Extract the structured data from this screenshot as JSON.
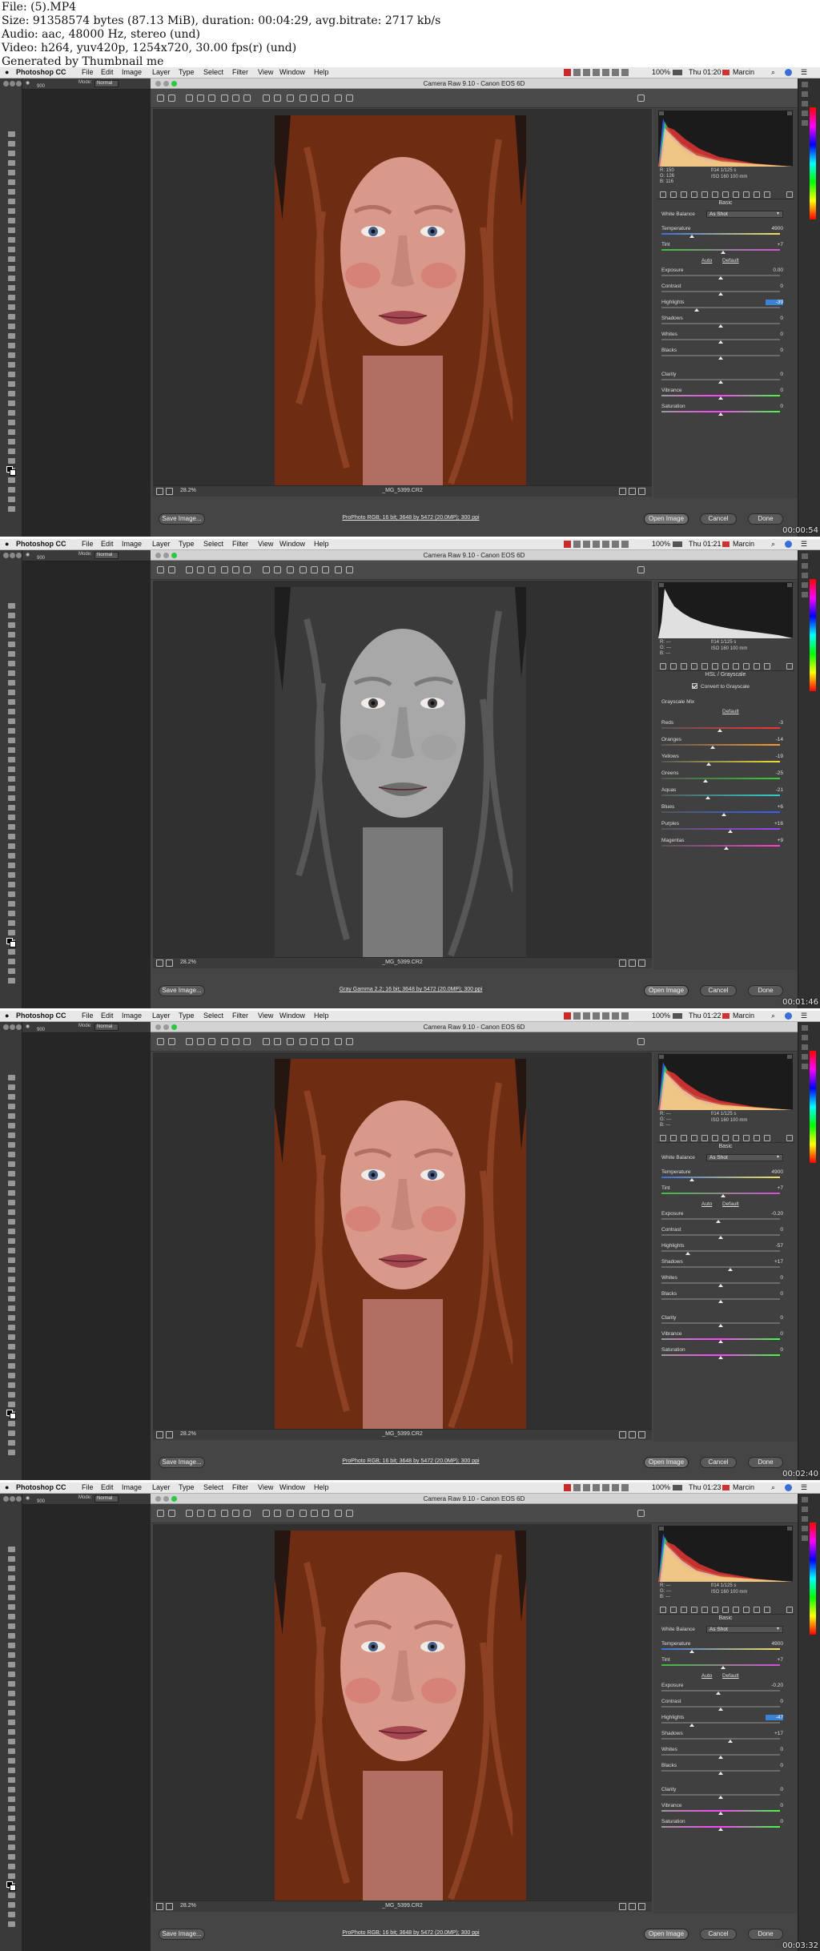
{
  "info": {
    "lines": [
      "File: (5).MP4",
      "Size: 91358574 bytes (87.13 MiB), duration: 00:04:29, avg.bitrate: 2717 kb/s",
      "Audio: aac, 48000 Hz, stereo (und)",
      "Video: h264, yuv420p, 1254x720, 30.00 fps(r) (und)",
      "Generated by Thumbnail me"
    ]
  },
  "common": {
    "app": "Photoshop CC",
    "menus": [
      "File",
      "Edit",
      "Image",
      "Layer",
      "Type",
      "Select",
      "Filter",
      "View",
      "Window",
      "Help"
    ],
    "window_title": "Camera Raw 9.10 - Canon EOS 6D",
    "user": "Marcin",
    "battery": "100%",
    "camera_line1": "f/14   1/125 s",
    "camera_line2": "ISO 160   100 mm",
    "zoom": "28.2%",
    "file_name": "_MG_5399.CR2",
    "save_button": "Save Image...",
    "open_button": "Open Image",
    "cancel_button": "Cancel",
    "done_button": "Done",
    "brush_size": "900",
    "mode_label": "Mode:",
    "mode_value": "Normal",
    "auto_label": "Auto",
    "default_label": "Default",
    "convert_label": "Convert to Grayscale",
    "grayscale_mix_label": "Grayscale Mix"
  },
  "frames": [
    {
      "time": "Thu 01:20",
      "timestamp": "00:00:54",
      "mode": "color",
      "panel_title": "Basic",
      "rgb": [
        "R: 150",
        "G: 126",
        "B: 116"
      ],
      "workflow": "ProPhoto RGB; 16 bit; 3648 by 5472 (20.0MP); 300 ppi",
      "wb_value": "As Shot",
      "rows": [
        {
          "label": "White Balance",
          "type": "wb"
        },
        {
          "label": "Temperature",
          "value": "4900",
          "pos": 0.26,
          "grad": "temp"
        },
        {
          "label": "Tint",
          "value": "+7",
          "pos": 0.52,
          "grad": "tint"
        },
        {
          "type": "auto"
        },
        {
          "label": "Exposure",
          "value": "0.00",
          "pos": 0.5
        },
        {
          "label": "Contrast",
          "value": "0",
          "pos": 0.5
        },
        {
          "label": "Highlights",
          "value": "-39",
          "pos": 0.3,
          "hl": true
        },
        {
          "label": "Shadows",
          "value": "0",
          "pos": 0.5
        },
        {
          "label": "Whites",
          "value": "0",
          "pos": 0.5
        },
        {
          "label": "Blacks",
          "value": "0",
          "pos": 0.5
        },
        {
          "type": "gap"
        },
        {
          "label": "Clarity",
          "value": "0",
          "pos": 0.5
        },
        {
          "label": "Vibrance",
          "value": "0",
          "pos": 0.5,
          "grad": "sat"
        },
        {
          "label": "Saturation",
          "value": "0",
          "pos": 0.5,
          "grad": "sat"
        }
      ]
    },
    {
      "time": "Thu 01:21",
      "timestamp": "00:01:46",
      "mode": "gray",
      "panel_title": "HSL / Grayscale",
      "rgb": [
        "R: ---",
        "G: ---",
        "B: ---"
      ],
      "workflow": "Gray Gamma 2.2; 16 bit; 3648 by 5472 (20.0MP); 300 ppi",
      "rows": [
        {
          "type": "convert"
        },
        {
          "type": "mix"
        },
        {
          "type": "defaultonly"
        },
        {
          "label": "Reds",
          "value": "-3",
          "pos": 0.49,
          "grad": "red"
        },
        {
          "label": "Oranges",
          "value": "-14",
          "pos": 0.43,
          "grad": "orange"
        },
        {
          "label": "Yellows",
          "value": "-19",
          "pos": 0.4,
          "grad": "yellow"
        },
        {
          "label": "Greens",
          "value": "-25",
          "pos": 0.37,
          "grad": "green"
        },
        {
          "label": "Aquas",
          "value": "-21",
          "pos": 0.39,
          "grad": "aqua"
        },
        {
          "label": "Blues",
          "value": "+6",
          "pos": 0.53,
          "grad": "blue"
        },
        {
          "label": "Purples",
          "value": "+16",
          "pos": 0.58,
          "grad": "purple"
        },
        {
          "label": "Magentas",
          "value": "+9",
          "pos": 0.55,
          "grad": "magenta"
        }
      ]
    },
    {
      "time": "Thu 01:22",
      "timestamp": "00:02:40",
      "mode": "color",
      "panel_title": "Basic",
      "rgb": [
        "R: ---",
        "G: ---",
        "B: ---"
      ],
      "workflow": "ProPhoto RGB; 16 bit; 3648 by 5472 (20.0MP); 300 ppi",
      "wb_value": "As Shot",
      "rows": [
        {
          "label": "White Balance",
          "type": "wb"
        },
        {
          "label": "Temperature",
          "value": "4900",
          "pos": 0.26,
          "grad": "temp"
        },
        {
          "label": "Tint",
          "value": "+7",
          "pos": 0.52,
          "grad": "tint"
        },
        {
          "type": "auto"
        },
        {
          "label": "Exposure",
          "value": "-0.20",
          "pos": 0.48
        },
        {
          "label": "Contrast",
          "value": "0",
          "pos": 0.5
        },
        {
          "label": "Highlights",
          "value": "-57",
          "pos": 0.22
        },
        {
          "label": "Shadows",
          "value": "+17",
          "pos": 0.58
        },
        {
          "label": "Whites",
          "value": "0",
          "pos": 0.5
        },
        {
          "label": "Blacks",
          "value": "0",
          "pos": 0.5
        },
        {
          "type": "gap"
        },
        {
          "label": "Clarity",
          "value": "0",
          "pos": 0.5
        },
        {
          "label": "Vibrance",
          "value": "0",
          "pos": 0.5,
          "grad": "sat"
        },
        {
          "label": "Saturation",
          "value": "0",
          "pos": 0.5,
          "grad": "sat"
        }
      ]
    },
    {
      "time": "Thu 01:23",
      "timestamp": "00:03:32",
      "mode": "color",
      "panel_title": "Basic",
      "rgb": [
        "R: ---",
        "G: ---",
        "B: ---"
      ],
      "workflow": "ProPhoto RGB; 16 bit; 3648 by 5472 (20.0MP); 300 ppi",
      "wb_value": "As Shot",
      "rows": [
        {
          "label": "White Balance",
          "type": "wb"
        },
        {
          "label": "Temperature",
          "value": "4900",
          "pos": 0.26,
          "grad": "temp"
        },
        {
          "label": "Tint",
          "value": "+7",
          "pos": 0.52,
          "grad": "tint"
        },
        {
          "type": "auto"
        },
        {
          "label": "Exposure",
          "value": "-0.20",
          "pos": 0.48
        },
        {
          "label": "Contrast",
          "value": "0",
          "pos": 0.5
        },
        {
          "label": "Highlights",
          "value": "-47",
          "pos": 0.26,
          "hl": true
        },
        {
          "label": "Shadows",
          "value": "+17",
          "pos": 0.58
        },
        {
          "label": "Whites",
          "value": "0",
          "pos": 0.5
        },
        {
          "label": "Blacks",
          "value": "0",
          "pos": 0.5
        },
        {
          "type": "gap"
        },
        {
          "label": "Clarity",
          "value": "0",
          "pos": 0.5
        },
        {
          "label": "Vibrance",
          "value": "0",
          "pos": 0.5,
          "grad": "sat"
        },
        {
          "label": "Saturation",
          "value": "0",
          "pos": 0.5,
          "grad": "sat"
        }
      ]
    }
  ]
}
